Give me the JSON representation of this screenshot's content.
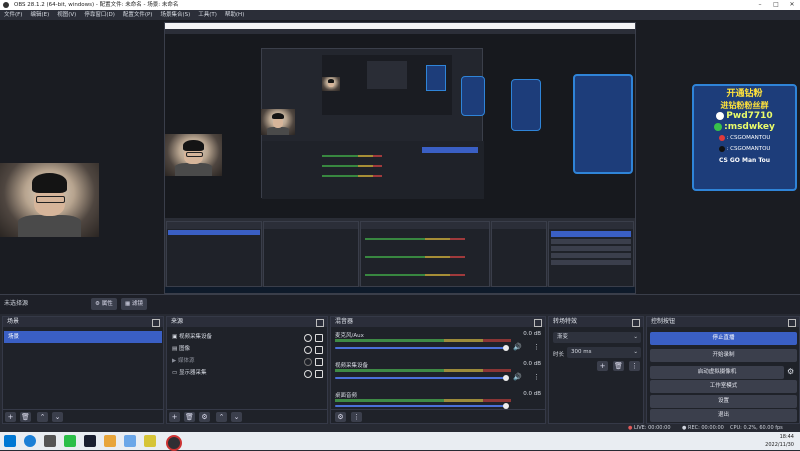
{
  "window": {
    "title": "OBS 28.1.2 (64-bit, windows) - 配置文件: 未命名 - 场景: 未命名"
  },
  "menu": [
    "文件(F)",
    "编辑(E)",
    "视图(V)",
    "停靠窗口(D)",
    "配置文件(P)",
    "场景集合(S)",
    "工具(T)",
    "帮助(H)"
  ],
  "banner": {
    "title": "开通钻粉",
    "subtitle": "进钻粉粉丝群",
    "pwd": "Pwd7710",
    "wechat": ":msdwkey",
    "weibo": ": CSGOMANTOU",
    "douyin": ": CSGOMANTOU",
    "footer": "CS GO Man Tou"
  },
  "toolbar": {
    "no_source": "未选择源",
    "properties": "属性",
    "filters": "滤镜"
  },
  "scenes": {
    "title": "场景",
    "items": [
      "场景"
    ]
  },
  "sources": {
    "title": "来源",
    "items": [
      {
        "name": "视频采集设备",
        "icon": "camera-icon"
      },
      {
        "name": "图像",
        "icon": "image-icon"
      },
      {
        "name": "媒体源",
        "icon": "media-icon"
      },
      {
        "name": "显示器采集",
        "icon": "monitor-icon"
      }
    ]
  },
  "mixer": {
    "title": "混音器",
    "channels": [
      {
        "name": "麦克风/Aux",
        "db": "0.0 dB"
      },
      {
        "name": "视频采集设备",
        "db": "0.0 dB"
      },
      {
        "name": "桌面音频",
        "db": "0.0 dB"
      }
    ]
  },
  "transitions": {
    "title": "转场特效",
    "type": "渐变",
    "duration_label": "时长",
    "duration": "300 ms"
  },
  "controls": {
    "title": "控制按钮",
    "buttons": [
      "停止直播",
      "开始录制",
      "启动虚拟摄像机",
      "工作室模式",
      "设置",
      "退出"
    ]
  },
  "status": {
    "live": "LIVE: 00:00:00",
    "rec": "REC: 00:00:00",
    "cpu": "CPU: 0.2%, 60.00 fps"
  },
  "taskbar": {
    "time": "18:44",
    "date": "2022/11/30"
  },
  "colors": {
    "accent": "#3a5fc4",
    "banner_bg": "#1d3d7a",
    "banner_border": "#2f84d8",
    "banner_yellow": "#ffe23b"
  }
}
